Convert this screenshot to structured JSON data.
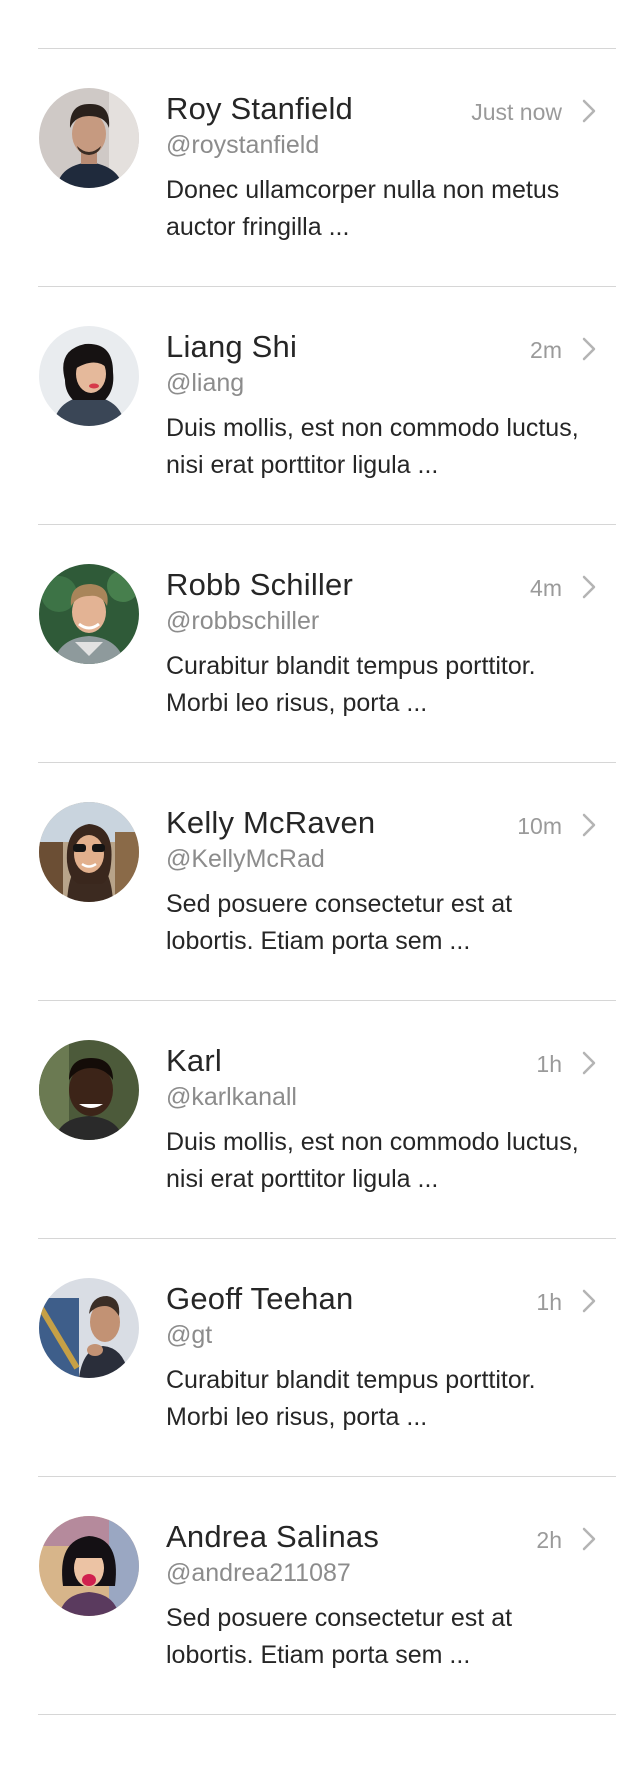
{
  "messages": [
    {
      "name": "Roy Stanfield",
      "handle": "@roystanfield",
      "time": "Just now",
      "snippet": "Donec ullamcorper nulla non metus auctor fringilla ...",
      "avatar_icon": "avatar-roy-stanfield"
    },
    {
      "name": "Liang Shi",
      "handle": "@liang",
      "time": "2m",
      "snippet": "Duis mollis, est non commodo luctus, nisi erat porttitor ligula ...",
      "avatar_icon": "avatar-liang-shi"
    },
    {
      "name": "Robb Schiller",
      "handle": "@robbschiller",
      "time": "4m",
      "snippet": "Curabitur blandit tempus porttitor. Morbi leo risus, porta ...",
      "avatar_icon": "avatar-robb-schiller"
    },
    {
      "name": "Kelly McRaven",
      "handle": "@KellyMcRad",
      "time": "10m",
      "snippet": "Sed posuere consectetur est at lobortis. Etiam porta sem ...",
      "avatar_icon": "avatar-kelly-mcraven"
    },
    {
      "name": "Karl",
      "handle": "@karlkanall",
      "time": "1h",
      "snippet": "Duis mollis, est non commodo luctus, nisi erat porttitor ligula ...",
      "avatar_icon": "avatar-karl"
    },
    {
      "name": "Geoff Teehan",
      "handle": "@gt",
      "time": "1h",
      "snippet": "Curabitur blandit tempus porttitor. Morbi leo risus, porta ...",
      "avatar_icon": "avatar-geoff-teehan"
    },
    {
      "name": "Andrea Salinas",
      "handle": "@andrea211087",
      "time": "2h",
      "snippet": "Sed posuere consectetur est at lobortis. Etiam porta sem ...",
      "avatar_icon": "avatar-andrea-salinas"
    }
  ],
  "colors": {
    "divider": "#d6d6d6",
    "name": "#262626",
    "handle": "#8c8c8c",
    "time": "#9a9a9a",
    "chevron": "#b4b4b4"
  }
}
